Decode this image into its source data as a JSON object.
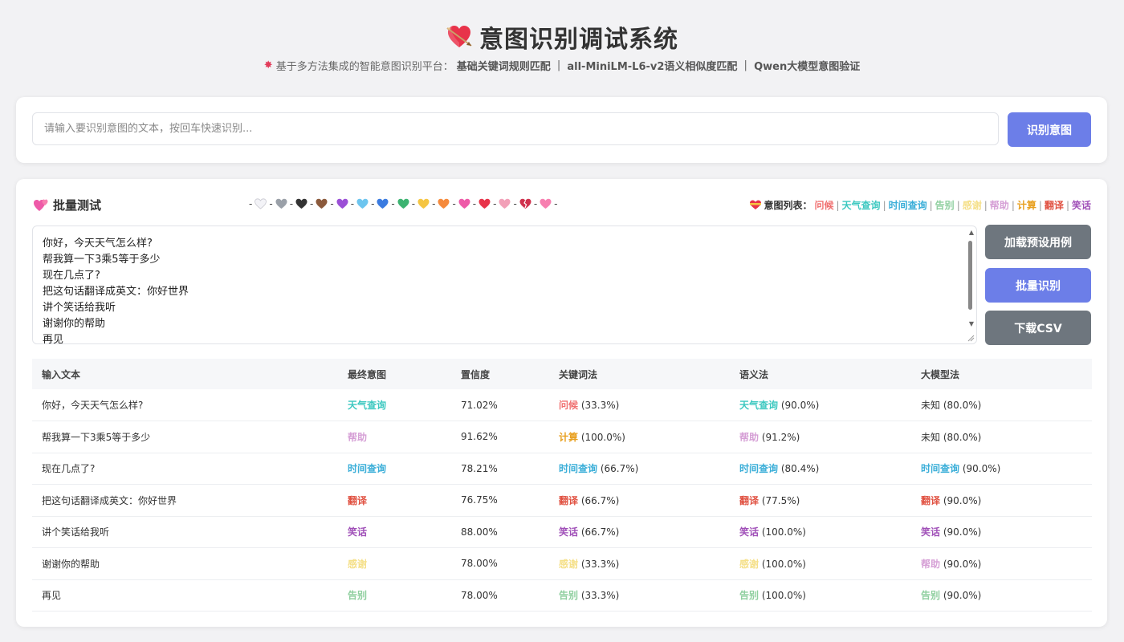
{
  "header": {
    "title": "意图识别调试系统",
    "subtitle_prefix": "基于多方法集成的智能意图识别平台：",
    "methods": [
      "基础关键词规则匹配",
      "all-MiniLM-L6-v2语义相似度匹配",
      "Qwen大模型意图验证"
    ],
    "method_sep": " | "
  },
  "search": {
    "placeholder": "请输入要识别意图的文本，按回车快速识别...",
    "value": "",
    "button_label": "识别意图"
  },
  "batch": {
    "title": "批量测试",
    "hearts": [
      "#f3f3f7",
      "#9aa0a8",
      "#333333",
      "#8b5a3c",
      "#9b4fd6",
      "#6dc5ef",
      "#3a7be0",
      "#3cb371",
      "#f5c542",
      "#f58a3c",
      "#ee5aa8",
      "#e8334a",
      "#f2a0b8",
      "#d0314d",
      "#f77fb0"
    ],
    "intent_list_label": "意图列表：",
    "intent_list": [
      {
        "name": "问候",
        "color": "#f07070"
      },
      {
        "name": "天气查询",
        "color": "#3cc8c0"
      },
      {
        "name": "时间查询",
        "color": "#3aaed8"
      },
      {
        "name": "告别",
        "color": "#8fcf9f"
      },
      {
        "name": "感谢",
        "color": "#f5e08a"
      },
      {
        "name": "帮助",
        "color": "#d6a0d6"
      },
      {
        "name": "计算",
        "color": "#e8a020"
      },
      {
        "name": "翻译",
        "color": "#e05040"
      },
      {
        "name": "笑话",
        "color": "#a050b8"
      }
    ],
    "textarea_value": "你好，今天天气怎么样?\n帮我算一下3乘5等于多少\n现在几点了?\n把这句话翻译成英文：你好世界\n讲个笑话给我听\n谢谢你的帮助\n再见",
    "buttons": {
      "load": "加载预设用例",
      "batch": "批量识别",
      "csv": "下载CSV"
    }
  },
  "table": {
    "headers": [
      "输入文本",
      "最终意图",
      "置信度",
      "关键词法",
      "语义法",
      "大模型法"
    ],
    "rows": [
      {
        "text": "你好，今天天气怎么样?",
        "final": {
          "name": "天气查询",
          "color": "#3cc8c0"
        },
        "confidence": "71.02%",
        "keyword": {
          "name": "问候",
          "color": "#f07070",
          "conf": "(33.3%)"
        },
        "semantic": {
          "name": "天气查询",
          "color": "#3cc8c0",
          "conf": "(90.0%)"
        },
        "llm": {
          "name": "未知",
          "color": "#333333",
          "conf": "(80.0%)"
        }
      },
      {
        "text": "帮我算一下3乘5等于多少",
        "final": {
          "name": "帮助",
          "color": "#d6a0d6"
        },
        "confidence": "91.62%",
        "keyword": {
          "name": "计算",
          "color": "#e8a020",
          "conf": "(100.0%)"
        },
        "semantic": {
          "name": "帮助",
          "color": "#d6a0d6",
          "conf": "(91.2%)"
        },
        "llm": {
          "name": "未知",
          "color": "#333333",
          "conf": "(80.0%)"
        }
      },
      {
        "text": "现在几点了?",
        "final": {
          "name": "时间查询",
          "color": "#3aaed8"
        },
        "confidence": "78.21%",
        "keyword": {
          "name": "时间查询",
          "color": "#3aaed8",
          "conf": "(66.7%)"
        },
        "semantic": {
          "name": "时间查询",
          "color": "#3aaed8",
          "conf": "(80.4%)"
        },
        "llm": {
          "name": "时间查询",
          "color": "#3aaed8",
          "conf": "(90.0%)"
        }
      },
      {
        "text": "把这句话翻译成英文：你好世界",
        "final": {
          "name": "翻译",
          "color": "#e05040"
        },
        "confidence": "76.75%",
        "keyword": {
          "name": "翻译",
          "color": "#e05040",
          "conf": "(66.7%)"
        },
        "semantic": {
          "name": "翻译",
          "color": "#e05040",
          "conf": "(77.5%)"
        },
        "llm": {
          "name": "翻译",
          "color": "#e05040",
          "conf": "(90.0%)"
        }
      },
      {
        "text": "讲个笑话给我听",
        "final": {
          "name": "笑话",
          "color": "#a050b8"
        },
        "confidence": "88.00%",
        "keyword": {
          "name": "笑话",
          "color": "#a050b8",
          "conf": "(66.7%)"
        },
        "semantic": {
          "name": "笑话",
          "color": "#a050b8",
          "conf": "(100.0%)"
        },
        "llm": {
          "name": "笑话",
          "color": "#a050b8",
          "conf": "(90.0%)"
        }
      },
      {
        "text": "谢谢你的帮助",
        "final": {
          "name": "感谢",
          "color": "#f5e08a"
        },
        "confidence": "78.00%",
        "keyword": {
          "name": "感谢",
          "color": "#f5e08a",
          "conf": "(33.3%)"
        },
        "semantic": {
          "name": "感谢",
          "color": "#f5e08a",
          "conf": "(100.0%)"
        },
        "llm": {
          "name": "帮助",
          "color": "#d6a0d6",
          "conf": "(90.0%)"
        }
      },
      {
        "text": "再见",
        "final": {
          "name": "告别",
          "color": "#8fcf9f"
        },
        "confidence": "78.00%",
        "keyword": {
          "name": "告别",
          "color": "#8fcf9f",
          "conf": "(33.3%)"
        },
        "semantic": {
          "name": "告别",
          "color": "#8fcf9f",
          "conf": "(100.0%)"
        },
        "llm": {
          "name": "告别",
          "color": "#8fcf9f",
          "conf": "(90.0%)"
        }
      }
    ]
  }
}
